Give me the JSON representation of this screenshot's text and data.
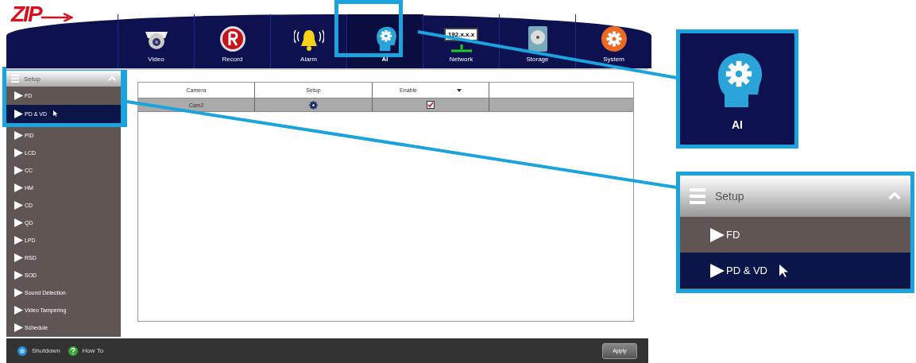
{
  "logo": {
    "text": "ZIP"
  },
  "tabs": [
    {
      "kind": "video",
      "label": "Video",
      "selected": false
    },
    {
      "kind": "record",
      "label": "Record",
      "selected": false
    },
    {
      "kind": "alarm",
      "label": "Alarm",
      "selected": false
    },
    {
      "kind": "ai",
      "label": "AI",
      "selected": true
    },
    {
      "kind": "network",
      "label": "Network",
      "selected": false,
      "screen_text": "192.x.x.x"
    },
    {
      "kind": "storage",
      "label": "Storage",
      "selected": false
    },
    {
      "kind": "system",
      "label": "System",
      "selected": false
    }
  ],
  "sidebar": {
    "title": "Setup",
    "expanded": true,
    "items": [
      {
        "label": "FD",
        "selected": false
      },
      {
        "label": "PD & VD",
        "selected": true
      },
      {
        "label": "PID",
        "selected": false
      },
      {
        "label": "LCD",
        "selected": false
      },
      {
        "label": "CC",
        "selected": false
      },
      {
        "label": "HM",
        "selected": false
      },
      {
        "label": "CD",
        "selected": false
      },
      {
        "label": "QD",
        "selected": false
      },
      {
        "label": "LPD",
        "selected": false
      },
      {
        "label": "RSD",
        "selected": false
      },
      {
        "label": "SOD",
        "selected": false
      },
      {
        "label": "Sound Detection",
        "selected": false
      },
      {
        "label": "Video Tampering",
        "selected": false
      },
      {
        "label": "Schedule",
        "selected": false
      }
    ]
  },
  "table": {
    "columns": [
      "Camera",
      "Setup",
      "Enable"
    ],
    "rows": [
      {
        "camera": "Cam2",
        "enabled": true
      }
    ]
  },
  "bottom_bar": {
    "shutdown": "Shutdown",
    "how_to": "How To",
    "apply": "Apply"
  },
  "ai_callout": {
    "label": "AI"
  },
  "setup_callout": {
    "title": "Setup",
    "items": [
      {
        "label": "FD",
        "selected": false
      },
      {
        "label": "PD & VD",
        "selected": true
      }
    ]
  }
}
